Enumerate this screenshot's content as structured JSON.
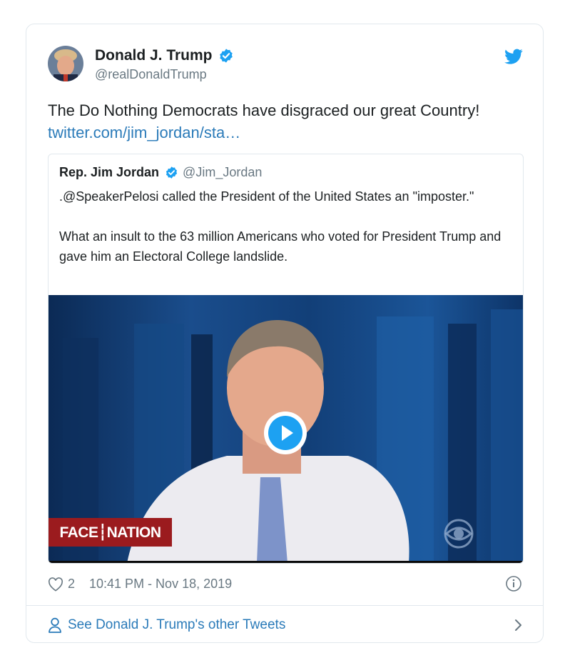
{
  "tweet": {
    "author_name": "Donald J. Trump",
    "author_handle": "@realDonaldTrump",
    "text": "The Do Nothing Democrats have disgraced our great Country!",
    "link_text": "twitter.com/jim_jordan/sta…",
    "like_count": "2",
    "timestamp": "10:41 PM - Nov 18, 2019"
  },
  "quoted": {
    "author_name": "Rep. Jim Jordan",
    "author_handle": "@Jim_Jordan",
    "text_p1": ".@SpeakerPelosi called the President of the United States an \"imposter.\"",
    "text_p2": "What an insult to the 63 million Americans who voted for President Trump and gave him an Electoral College landslide.",
    "video": {
      "lower_third": "FACE┆NATION"
    }
  },
  "footer": {
    "more_tweets_label": "See Donald J. Trump's other Tweets"
  },
  "icons": {
    "verified": "verified-badge-icon",
    "brand": "twitter-bird-icon",
    "like": "heart-icon",
    "info": "info-icon",
    "person": "person-icon",
    "chevron": "chevron-right-icon",
    "play": "play-icon",
    "network_logo": "cbs-eye-icon"
  },
  "colors": {
    "brand_blue": "#1da1f2",
    "link_blue": "#2b7bb9",
    "muted_gray": "#697882",
    "lower_third_red": "#9b1b1e"
  }
}
